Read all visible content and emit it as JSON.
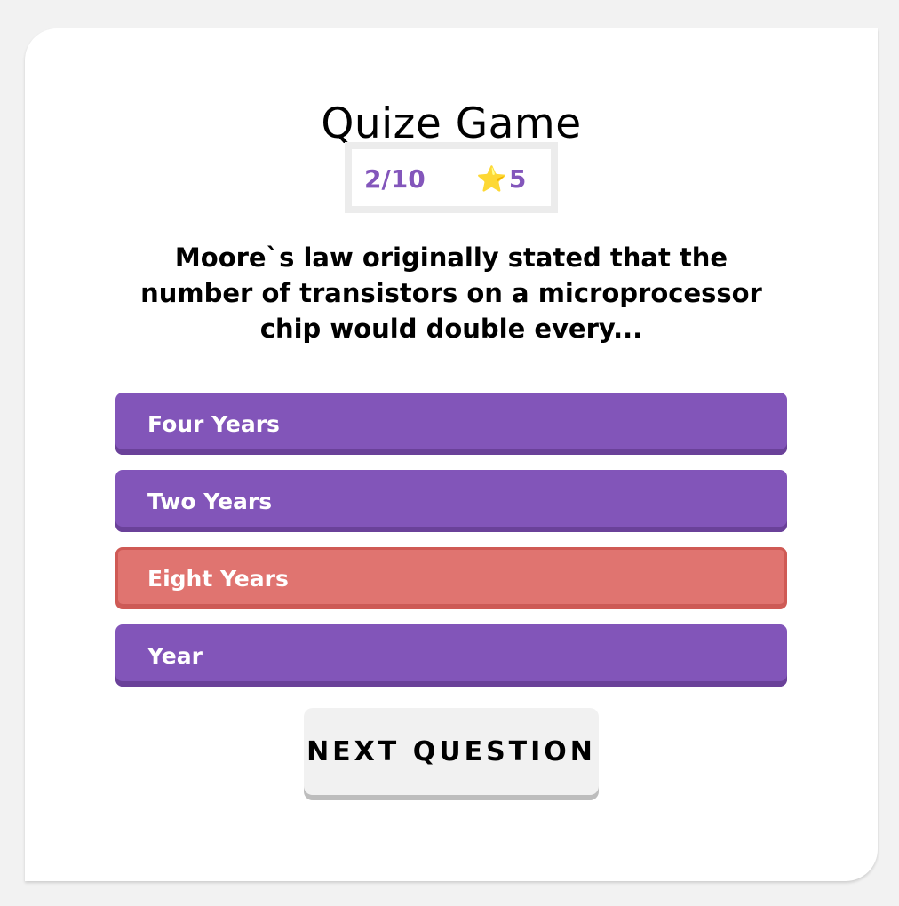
{
  "app": {
    "title": "Quize Game"
  },
  "stats": {
    "progress": "2/10",
    "score_icon": "star-icon",
    "score_glyph": "⭐",
    "score": "5"
  },
  "question": {
    "text": "Moore`s law originally stated that the number of transistors on a microprocessor chip would double every..."
  },
  "answers": [
    {
      "label": "Four Years",
      "state": "default"
    },
    {
      "label": "Two Years",
      "state": "default"
    },
    {
      "label": "Eight Years",
      "state": "wrong"
    },
    {
      "label": "Year",
      "state": "default"
    }
  ],
  "actions": {
    "next_label": "Next Question"
  },
  "colors": {
    "accent_purple": "#8255b9",
    "wrong_red": "#e07470",
    "stat_purple": "#8356bb"
  }
}
